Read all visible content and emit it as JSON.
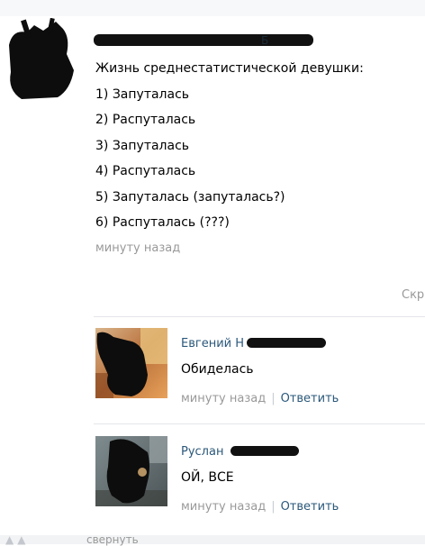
{
  "post": {
    "author_visible": "Б",
    "lines": [
      "Жизнь среднестатистической девушки:",
      "1) Запуталась",
      "2) Распуталась",
      "3) Запуталась",
      "4) Распуталась",
      "5) Запуталась (запуталась?)",
      "6) Распуталась (???)"
    ],
    "time": "минуту назад"
  },
  "collapse_hint": "Скр",
  "comments": [
    {
      "author": "Евгений Н",
      "text": "Обиделась",
      "time": "минуту назад",
      "separator": "|",
      "reply": "Ответить"
    },
    {
      "author": "Руслан",
      "text": "ОЙ, ВСЕ",
      "time": "минуту назад",
      "separator": "|",
      "reply": "Ответить"
    }
  ],
  "footer": {
    "text": "свернуть"
  },
  "colors": {
    "link": "#2b587a",
    "muted": "#999999",
    "divider": "#e4e6e9"
  }
}
